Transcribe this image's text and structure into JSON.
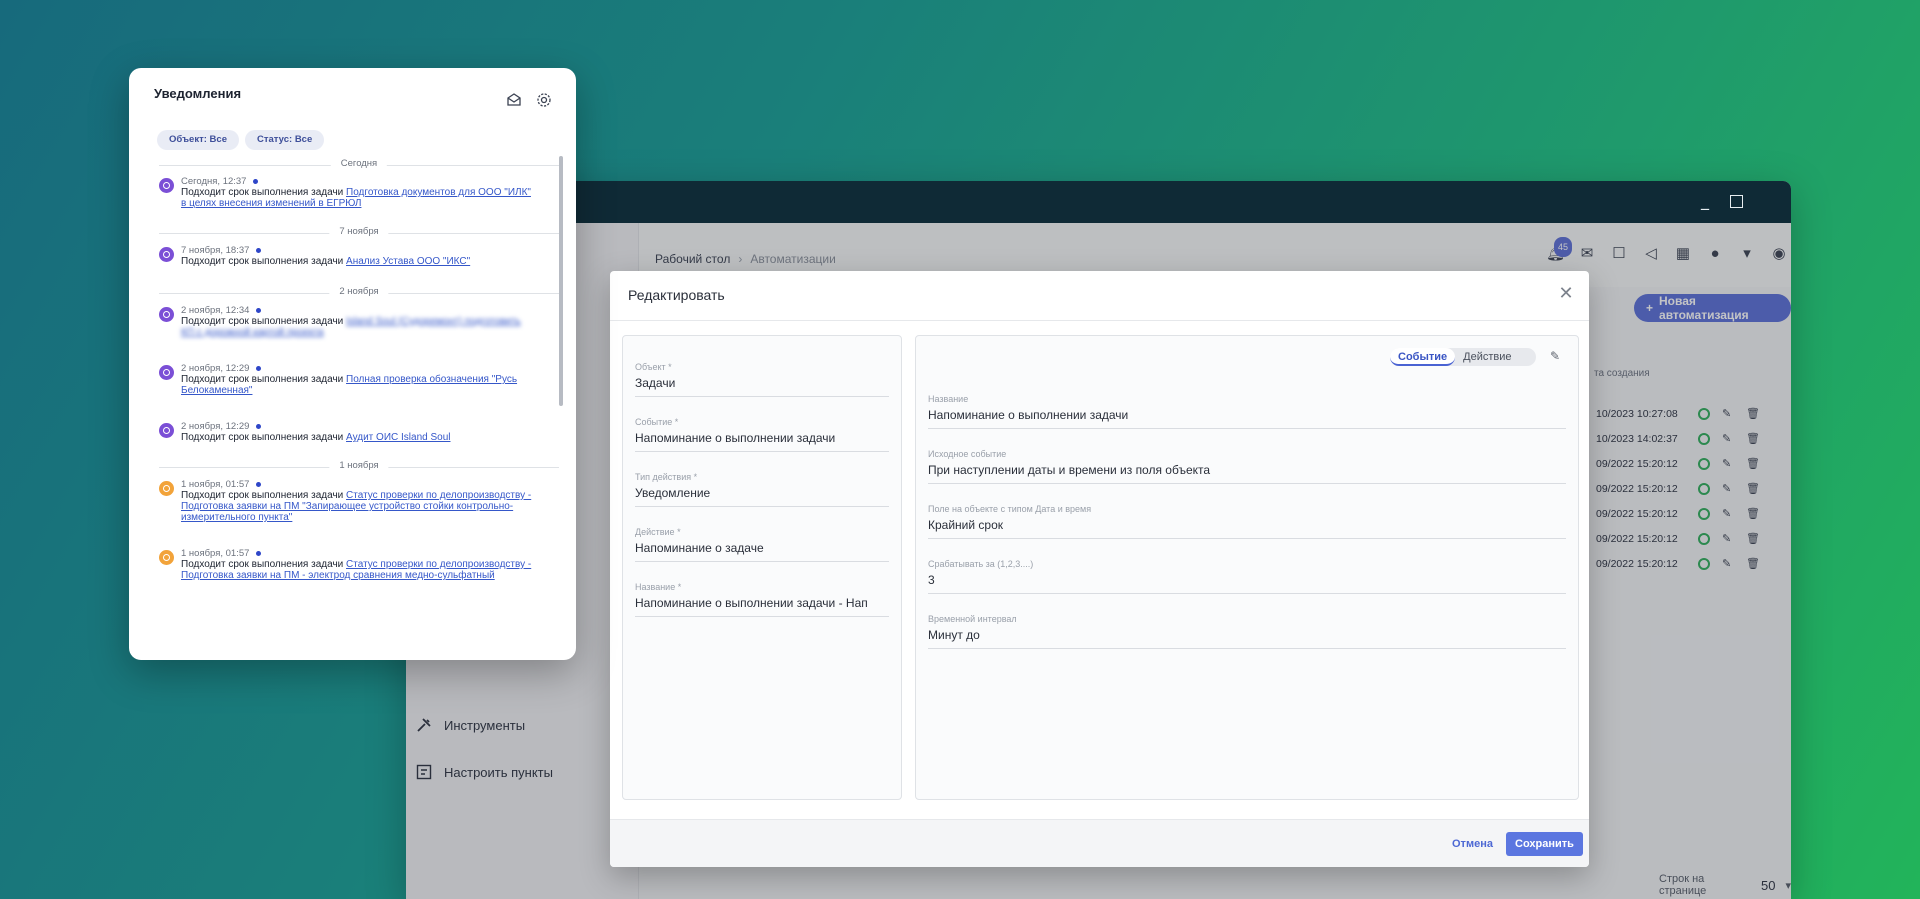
{
  "app": {
    "breadcrumbs": [
      "Рабочий стол",
      "Автоматизации"
    ],
    "notif_badge": "45",
    "new_automation_label": "Новая автоматизация",
    "sidebar": {
      "tools_label": "Инструменты",
      "configure_label": "Настроить пункты"
    },
    "table": {
      "col_created": "та создания",
      "rows": [
        "10/2023 10:27:08",
        "10/2023 14:02:37",
        "09/2022 15:20:12",
        "09/2022 15:20:12",
        "09/2022 15:20:12",
        "09/2022 15:20:12",
        "09/2022 15:20:12"
      ]
    },
    "footer": {
      "rows_per_page_label": "Строк на странице",
      "rows_per_page": "50"
    }
  },
  "modal": {
    "title": "Редактировать",
    "left_fields": [
      {
        "label": "Объект *",
        "value": "Задачи"
      },
      {
        "label": "Событие *",
        "value": "Напоминание о выполнении задачи"
      },
      {
        "label": "Тип действия *",
        "value": "Уведомление"
      },
      {
        "label": "Действие *",
        "value": "Напоминание о задаче"
      },
      {
        "label": "Название *",
        "value": "Напоминание о выполнении задачи - Нап"
      }
    ],
    "tabs": {
      "event": "Событие",
      "action": "Действие"
    },
    "right_fields": [
      {
        "label": "Название",
        "value": "Напоминание о выполнении задачи"
      },
      {
        "label": "Исходное событие",
        "value": "При наступлении даты и времени из поля объекта"
      },
      {
        "label": "Поле на объекте с типом Дата и время",
        "value": "Крайний срок"
      },
      {
        "label": "Срабатывать за (1,2,3....)",
        "value": "3"
      },
      {
        "label": "Временной интервал",
        "value": "Минут до"
      }
    ],
    "cancel_label": "Отмена",
    "save_label": "Сохранить"
  },
  "notifications": {
    "title": "Уведомления",
    "filter_object": "Объект: Все",
    "filter_status": "Статус: Все",
    "groups": [
      "Сегодня",
      "7 ноября",
      "2 ноября",
      "1 ноября"
    ],
    "items": [
      {
        "time": "Сегодня, 12:37",
        "text": "Подходит срок выполнения задачи ",
        "link": "Подготовка документов для ООО \"ИЛК\" в целях внесения изменений в ЕГРЮЛ",
        "color": "purple"
      },
      {
        "time": "7 ноября, 18:37",
        "text": "Подходит срок выполнения задачи ",
        "link": "Анализ Устава ООО \"ИКС\"",
        "color": "purple"
      },
      {
        "time": "2 ноября, 12:34",
        "text": "Подходит срок выполнения задачи ",
        "link": "Island Soul (Судоремонт) подготовить КП с дорожной картой проекта",
        "color": "purple"
      },
      {
        "time": "2 ноября, 12:29",
        "text": "Подходит срок выполнения задачи ",
        "link": "Полная проверка обозначения \"Русь Белокаменная\"",
        "color": "purple"
      },
      {
        "time": "2 ноября, 12:29",
        "text": "Подходит срок выполнения задачи ",
        "link": "Аудит ОИС Island Soul",
        "color": "purple"
      },
      {
        "time": "1 ноября, 01:57",
        "text": "Подходит срок выполнения задачи ",
        "link": "Статус проверки по делопроизводству - Подготовка заявки на ПМ \"Запирающее устройство стойки контрольно-измерительного пункта\"",
        "color": "orange"
      },
      {
        "time": "1 ноября, 01:57",
        "text": "Подходит срок выполнения задачи ",
        "link": "Статус проверки по делопроизводству - Подготовка заявки на ПМ - электрод сравнения медно-сульфатный",
        "color": "orange"
      }
    ]
  },
  "colors": {
    "accent": "#5a6fd8",
    "link": "#3557c9",
    "purple": "#7b4fd6",
    "orange": "#f2a33a",
    "ok_green": "#2fae5b"
  }
}
